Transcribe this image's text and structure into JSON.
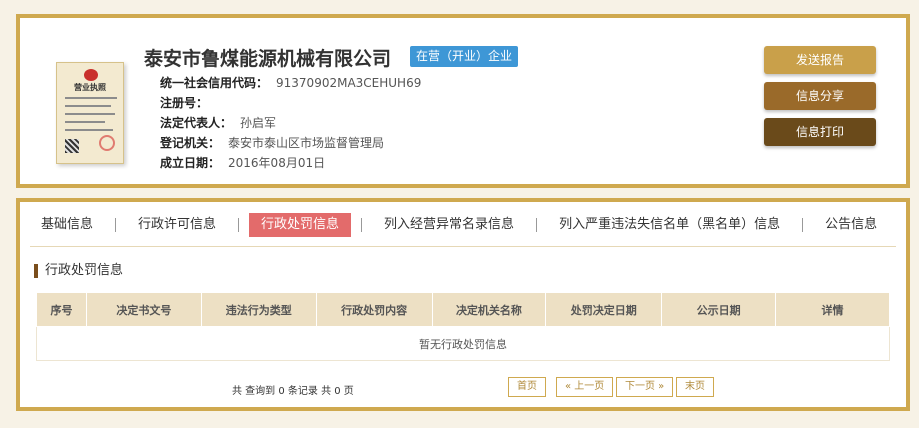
{
  "company": {
    "name": "泰安市鲁煤能源机械有限公司",
    "status": "在营（开业）企业",
    "license_title": "营业执照",
    "fields": [
      {
        "label": "统一社会信用代码：",
        "value": "91370902MA3CEHUH69"
      },
      {
        "label": "注册号：",
        "value": ""
      },
      {
        "label": "法定代表人：",
        "value": "孙启军"
      },
      {
        "label": "登记机关：",
        "value": "泰安市泰山区市场监督管理局"
      },
      {
        "label": "成立日期：",
        "value": "2016年08月01日"
      }
    ]
  },
  "actions": {
    "report": "发送报告",
    "share": "信息分享",
    "print": "信息打印"
  },
  "tabs": [
    {
      "label": "基础信息",
      "active": false
    },
    {
      "label": "行政许可信息",
      "active": false
    },
    {
      "label": "行政处罚信息",
      "active": true
    },
    {
      "label": "列入经营异常名录信息",
      "active": false
    },
    {
      "label": "列入严重违法失信名单（黑名单）信息",
      "active": false
    },
    {
      "label": "公告信息",
      "active": false
    }
  ],
  "section_title": "行政处罚信息",
  "table": {
    "columns": [
      "序号",
      "决定书文号",
      "违法行为类型",
      "行政处罚内容",
      "决定机关名称",
      "处罚决定日期",
      "公示日期",
      "详情"
    ],
    "empty_text": "暂无行政处罚信息"
  },
  "pager": {
    "summary": "共 查询到 0 条记录 共 0 页",
    "first": "首页",
    "prev": "« 上一页",
    "next": "下一页 »",
    "last": "末页"
  },
  "colors": {
    "accent_border": "#cfa94f",
    "active_tab": "#e36b6b",
    "status_badge": "#3e97d6",
    "btn_report": "#c9a04a",
    "btn_share": "#9a6a2a",
    "btn_print": "#6a4a1a"
  }
}
